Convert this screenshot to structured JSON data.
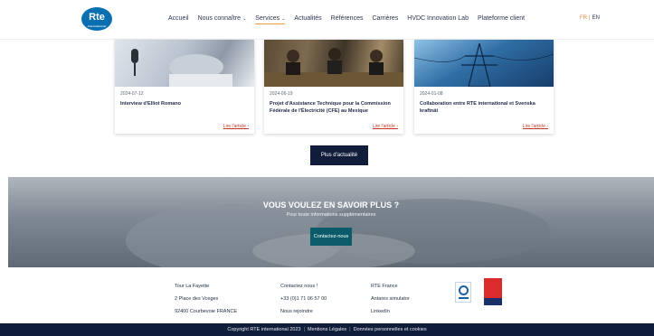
{
  "header": {
    "logo_text": "Rte",
    "logo_sub": "international",
    "nav": [
      {
        "label": "Accueil",
        "caret": false,
        "active": false
      },
      {
        "label": "Nous connaître",
        "caret": true,
        "active": false
      },
      {
        "label": "Services",
        "caret": true,
        "active": true
      },
      {
        "label": "Actualités",
        "caret": false,
        "active": false
      },
      {
        "label": "Références",
        "caret": false,
        "active": false
      },
      {
        "label": "Carrières",
        "caret": false,
        "active": false
      },
      {
        "label": "HVDC Innovation Lab",
        "caret": false,
        "active": false
      },
      {
        "label": "Plateforme client",
        "caret": false,
        "active": false
      }
    ],
    "lang": {
      "fr": "FR",
      "sep": "|",
      "en": "EN"
    }
  },
  "news": [
    {
      "date": "2024-07-12",
      "title": "Interview d'Elliot Romano",
      "link": "Lire l'article ›"
    },
    {
      "date": "2024-06-19",
      "title": "Projet d'Assistance Technique pour la Commission Fédérale de l'Électricité (CFE) au Mexique",
      "link": "Lire l'article ›"
    },
    {
      "date": "2024-01-08",
      "title": "Collaboration entre RTE international et Svenska kraftnät",
      "link": "Lire l'article ›"
    }
  ],
  "more_button": "Plus d'actualité",
  "cta": {
    "title": "VOUS VOULEZ EN SAVOIR PLUS ?",
    "subtitle": "Pour toute informations supplémentaires",
    "button": "Contactez-nous"
  },
  "footer": {
    "address": [
      "Tour La Fayette",
      "2 Place des Vosges",
      "92400 Courbevoie FRANCE"
    ],
    "contact": [
      "Contactez nous !",
      "+33 (0)1 71 06 57 00",
      "Nous rejoindre"
    ],
    "links": [
      "RTE France",
      "Antares simulator",
      "LinkedIn"
    ]
  },
  "copyright": {
    "text": "Copyright RTE international 2023",
    "links": [
      "Mentions Légales",
      "Données personnelles et cookies"
    ]
  },
  "colors": {
    "navy": "#0f1d3a",
    "accent": "#e08a3c",
    "teal": "#0c5b6b",
    "link_red": "#c0392b"
  }
}
